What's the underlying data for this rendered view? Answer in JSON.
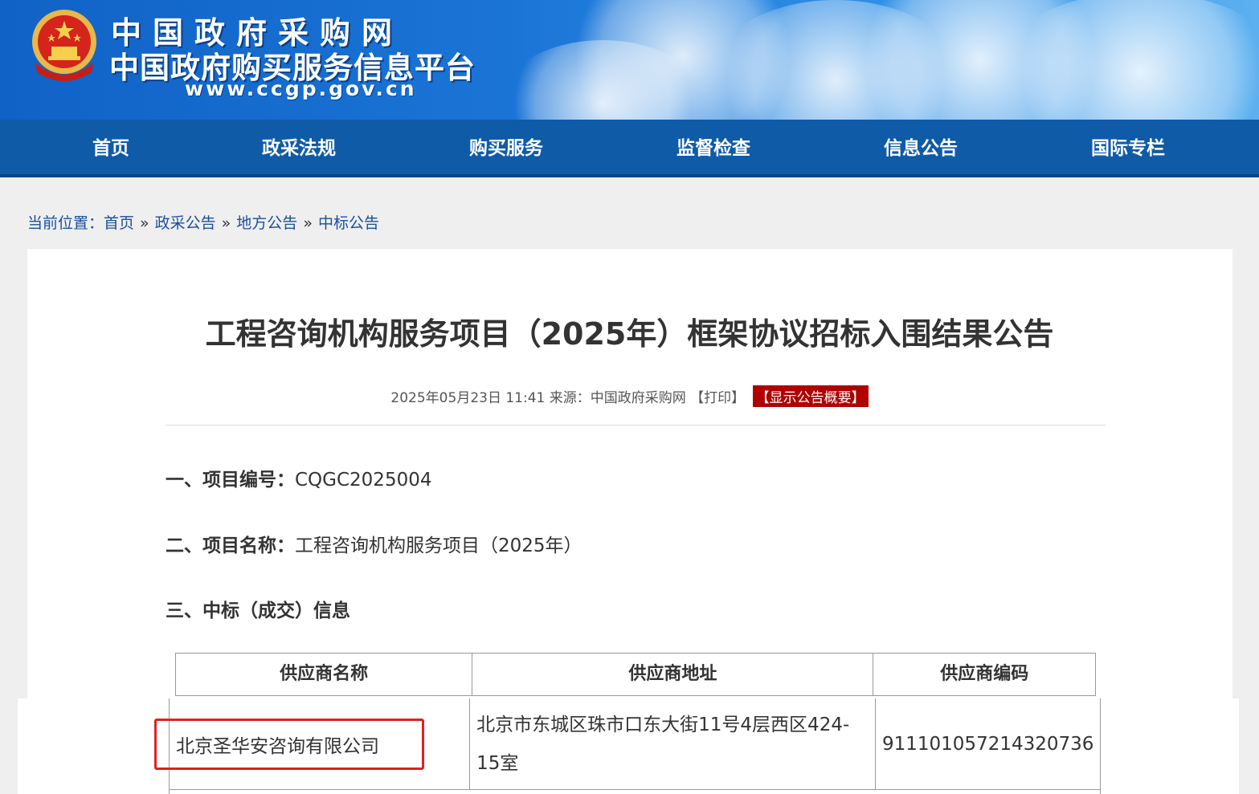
{
  "header": {
    "site_title_line1": "中国政府采购网",
    "site_title_line2": "中国政府购买服务信息平台",
    "site_url": "www.ccgp.gov.cn",
    "emblem_icon": "national-emblem-icon"
  },
  "nav": {
    "items": [
      {
        "label": "首页"
      },
      {
        "label": "政采法规"
      },
      {
        "label": "购买服务"
      },
      {
        "label": "监督检查"
      },
      {
        "label": "信息公告"
      },
      {
        "label": "国际专栏"
      }
    ]
  },
  "breadcrumb": {
    "prefix": "当前位置：",
    "items": [
      "首页",
      "政采公告",
      "地方公告",
      "中标公告"
    ],
    "separator": "»"
  },
  "article": {
    "title": "工程咨询机构服务项目（2025年）框架协议招标入围结果公告",
    "meta_datetime": "2025年05月23日 11:41",
    "meta_source": "来源：中国政府采购网",
    "print_label": "【打印】",
    "summary_label": "【显示公告概要】",
    "sections": [
      {
        "label": "一、项目编号：",
        "value": "CQGC2025004"
      },
      {
        "label": "二、项目名称：",
        "value": "工程咨询机构服务项目（2025年）"
      },
      {
        "label": "三、中标（成交）信息",
        "value": ""
      }
    ],
    "table": {
      "headers": [
        "供应商名称",
        "供应商地址",
        "供应商编码"
      ],
      "rows": [
        [
          "北京圣华安咨询有限公司",
          "北京市东城区珠市口东大街11号4层西区424-15室",
          "911101057214320736"
        ]
      ]
    }
  },
  "colors": {
    "nav_bg": "#0f5ba8",
    "summary_badge": "#b00000",
    "highlight": "#e02020"
  }
}
